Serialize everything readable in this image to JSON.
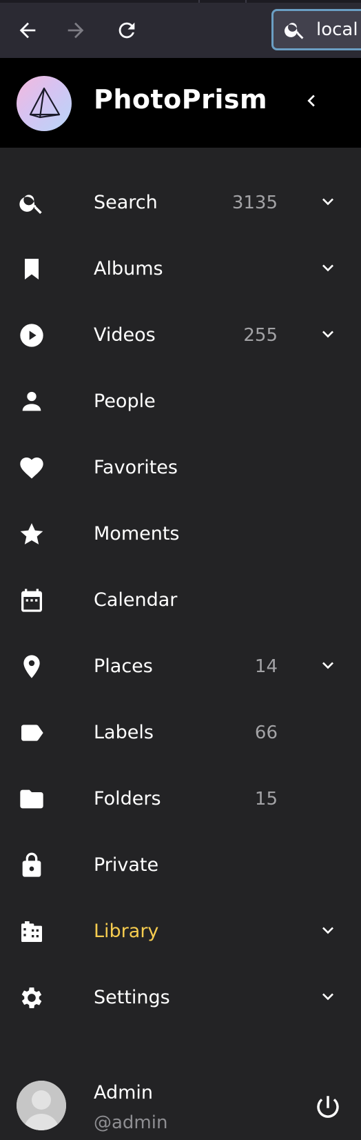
{
  "browser": {
    "url_value": "local",
    "icons": [
      "back-arrow-icon",
      "forward-arrow-icon",
      "reload-icon",
      "search-icon"
    ]
  },
  "header": {
    "title": "PhotoPrism",
    "logo_icon": "photoprism-triangle-logo",
    "collapse_icon": "chevron-left-icon"
  },
  "nav": {
    "items": [
      {
        "label": "Search",
        "count": "3135",
        "icon": "search-icon",
        "expandable": true
      },
      {
        "label": "Albums",
        "count": "",
        "icon": "bookmark-icon",
        "expandable": true
      },
      {
        "label": "Videos",
        "count": "255",
        "icon": "play-circle-icon",
        "expandable": true
      },
      {
        "label": "People",
        "count": "",
        "icon": "person-icon",
        "expandable": false
      },
      {
        "label": "Favorites",
        "count": "",
        "icon": "heart-icon",
        "expandable": false
      },
      {
        "label": "Moments",
        "count": "",
        "icon": "star-icon",
        "expandable": false
      },
      {
        "label": "Calendar",
        "count": "",
        "icon": "calendar-icon",
        "expandable": false
      },
      {
        "label": "Places",
        "count": "14",
        "icon": "map-pin-icon",
        "expandable": true
      },
      {
        "label": "Labels",
        "count": "66",
        "icon": "label-tag-icon",
        "expandable": false
      },
      {
        "label": "Folders",
        "count": "15",
        "icon": "folder-icon",
        "expandable": false
      },
      {
        "label": "Private",
        "count": "",
        "icon": "lock-icon",
        "expandable": false
      },
      {
        "label": "Library",
        "count": "",
        "icon": "film-library-icon",
        "expandable": true,
        "active": true
      },
      {
        "label": "Settings",
        "count": "",
        "icon": "gear-icon",
        "expandable": true
      }
    ]
  },
  "user": {
    "name": "Admin",
    "handle": "@admin",
    "power_icon": "power-icon"
  },
  "colors": {
    "background": "#232325",
    "header_bg": "#000000",
    "toolbar_bg": "#2b2a33",
    "active_label": "#f6cc4f",
    "count_text": "#a3a3a6",
    "url_border": "#6b9fc4"
  }
}
